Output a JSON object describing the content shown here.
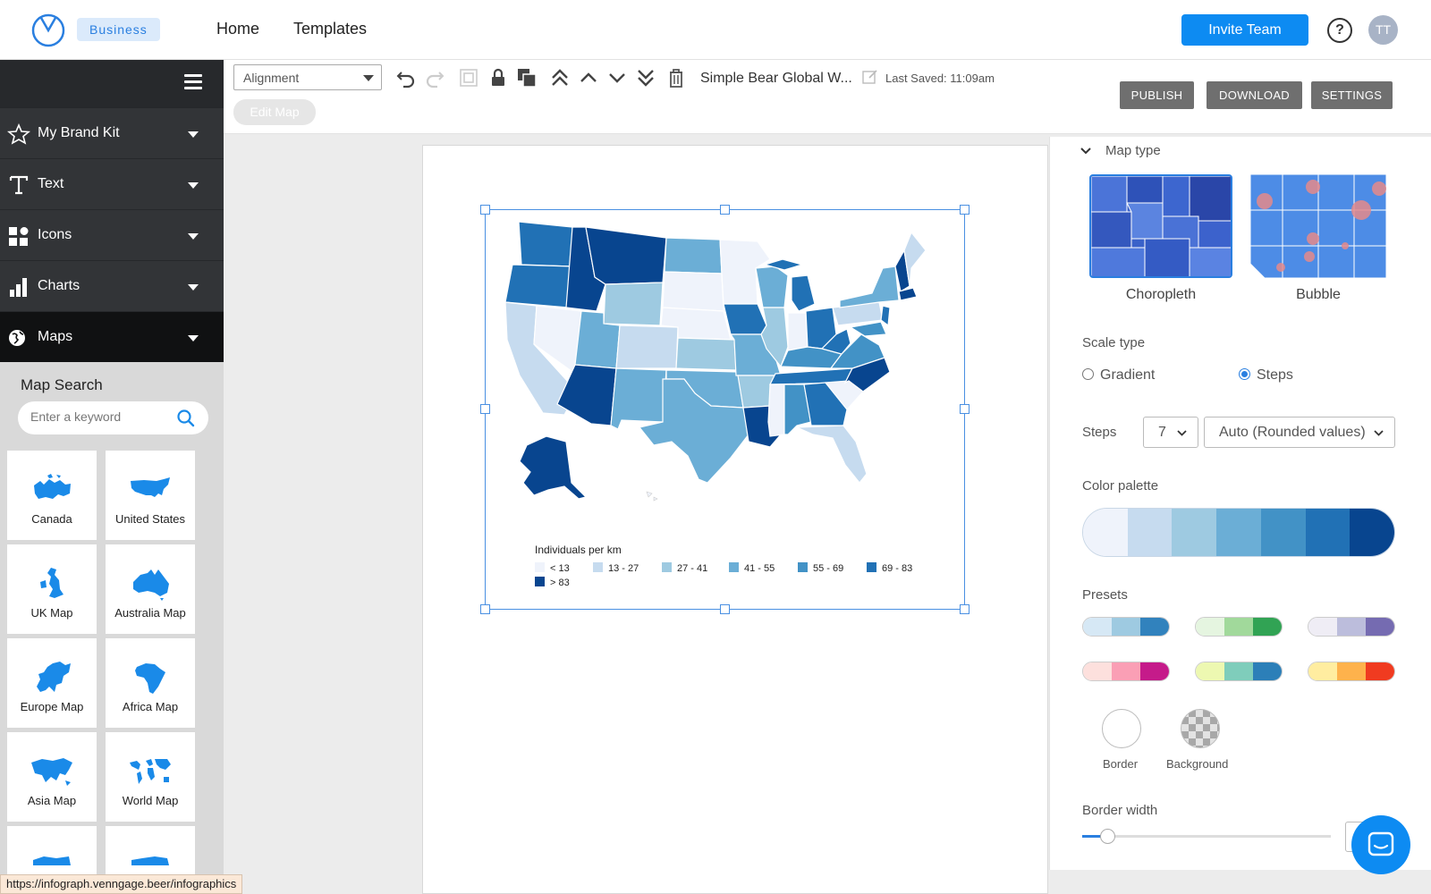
{
  "topbar": {
    "badge": "Business",
    "nav": [
      "Home",
      "Templates"
    ],
    "invite_label": "Invite Team",
    "help_label": "?",
    "avatar_initials": "TT"
  },
  "sidebar": {
    "items": [
      {
        "label": "My Brand Kit",
        "icon": "star-icon"
      },
      {
        "label": "Text",
        "icon": "text-icon"
      },
      {
        "label": "Icons",
        "icon": "icons-grid-icon"
      },
      {
        "label": "Charts",
        "icon": "bar-chart-icon"
      },
      {
        "label": "Maps",
        "icon": "globe-icon"
      }
    ],
    "map_search_title": "Map Search",
    "search_placeholder": "Enter a keyword",
    "maps": [
      "Canada",
      "United States",
      "UK Map",
      "Australia Map",
      "Europe Map",
      "Africa Map",
      "Asia Map",
      "World Map"
    ]
  },
  "toolbar": {
    "alignment": "Alignment",
    "doc_title": "Simple Bear Global W...",
    "last_saved": "Last Saved: 11:09am",
    "edit_map": "Edit Map",
    "publish": "PUBLISH",
    "download": "DOWNLOAD",
    "settings": "SETTINGS"
  },
  "map_legend": {
    "title": "Individuals per km",
    "items": [
      "< 13",
      "13 - 27",
      "27 - 41",
      "41 - 55",
      "55 - 69",
      "69 - 83",
      "> 83"
    ]
  },
  "panel": {
    "map_type_label": "Map type",
    "map_types": [
      "Choropleth",
      "Bubble"
    ],
    "scale_type_label": "Scale type",
    "scale_options": [
      "Gradient",
      "Steps"
    ],
    "scale_selected": "Steps",
    "steps_label": "Steps",
    "steps_value": "7",
    "rounding_value": "Auto (Rounded values)",
    "color_palette_label": "Color palette",
    "palette": [
      "#eff3fb",
      "#c6dbef",
      "#9ecae1",
      "#6baed6",
      "#4292c6",
      "#2171b5",
      "#08458f"
    ],
    "presets_label": "Presets",
    "presets": [
      [
        "#d6e8f5",
        "#9ecae1",
        "#3182bd"
      ],
      [
        "#e5f5e0",
        "#a1d99b",
        "#31a354"
      ],
      [
        "#efedf5",
        "#bcbddc",
        "#756bb1"
      ],
      [
        "#fde0dd",
        "#fa9fb5",
        "#c51b8a"
      ],
      [
        "#edf8b1",
        "#7fcdbb",
        "#2c7fb8"
      ],
      [
        "#ffeda0",
        "#feb24c",
        "#f03b20"
      ]
    ],
    "border_label": "Border",
    "background_label": "Background",
    "border_width_label": "Border width",
    "border_width_value": 0.1
  },
  "status_url": "https://infograph.venngage.beer/infographics",
  "colors": {
    "accent": "#0d8bf2",
    "sidebar_dark": "#323437"
  }
}
